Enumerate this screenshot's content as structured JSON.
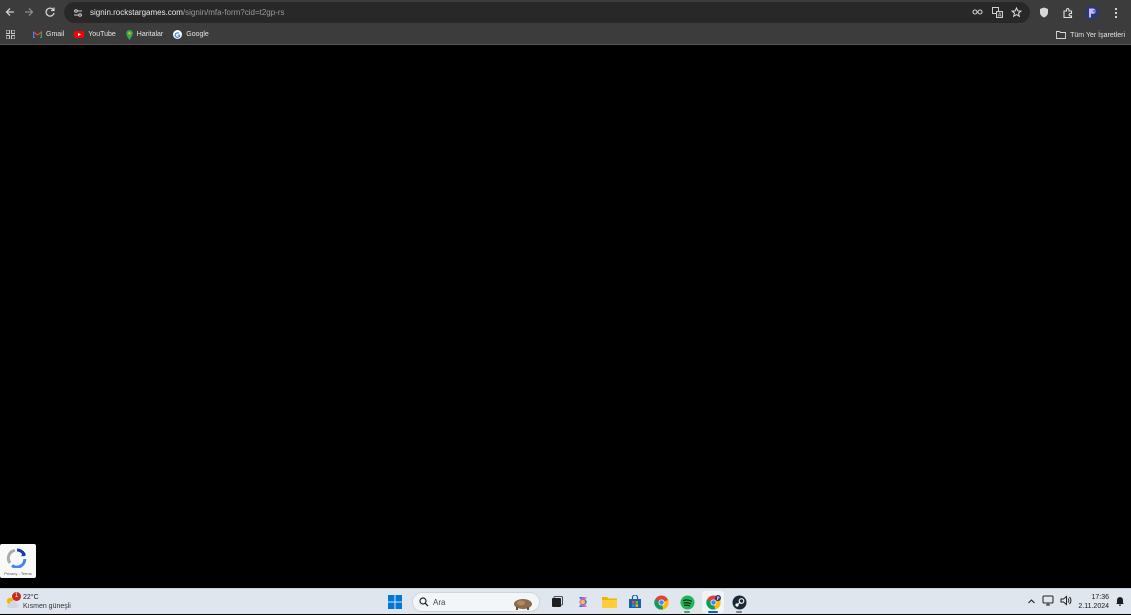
{
  "browser": {
    "url_host": "signin.rockstargames.com",
    "url_path": "/signin/mfa-form?cid=t2gp-rs"
  },
  "bookmarks": {
    "items": [
      {
        "label": "Gmail",
        "icon": "gmail-icon"
      },
      {
        "label": "YouTube",
        "icon": "youtube-icon"
      },
      {
        "label": "Haritalar",
        "icon": "maps-icon"
      },
      {
        "label": "Google",
        "icon": "google-icon"
      }
    ],
    "all_bookmarks_label": "Tüm Yer İşaretleri"
  },
  "recaptcha": {
    "footer": "Privacy - Terms"
  },
  "taskbar": {
    "weather": {
      "badge": "1",
      "temp": "22°C",
      "desc": "Kısmen güneşli"
    },
    "search_placeholder": "Ara",
    "clock": {
      "time": "17:36",
      "date": "2.11.2024"
    }
  },
  "colors": {
    "chrome_toolbar": "#3c3c3c",
    "omnibox": "#282828",
    "page_background": "#000000",
    "taskbar": "#dfe6ee",
    "accent": "#0067c0"
  }
}
